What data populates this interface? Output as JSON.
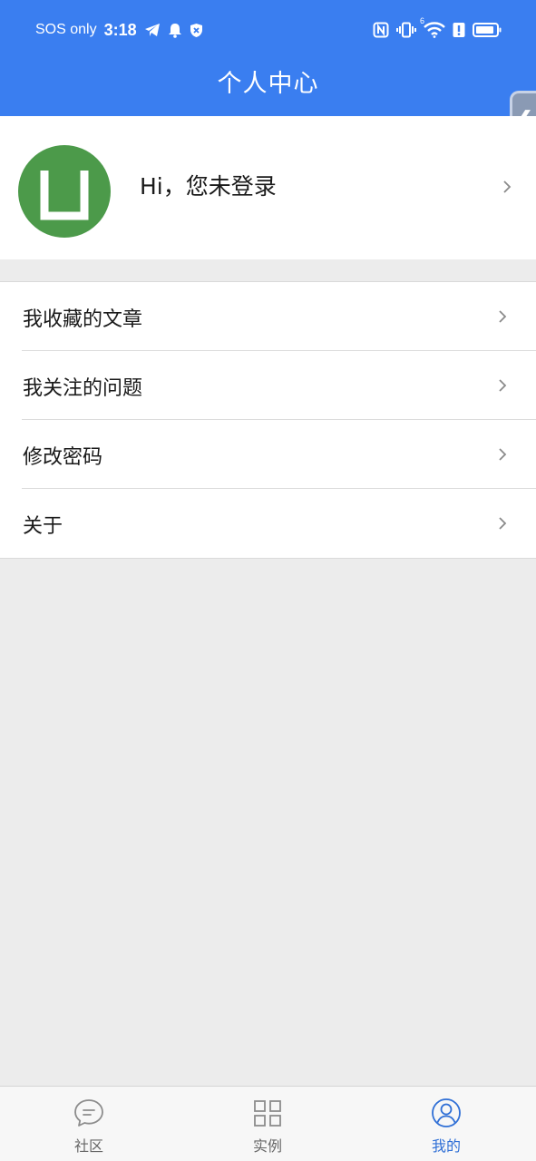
{
  "status_bar": {
    "carrier": "SOS only",
    "time": "3:18",
    "left_icons": [
      "telegram-icon",
      "bell-icon",
      "shield-icon"
    ],
    "right_icons": [
      "nfc-icon",
      "vibrate-icon",
      "wifi-icon",
      "alert-icon",
      "battery-icon"
    ],
    "wifi_badge": "6"
  },
  "header": {
    "title": "个人中心",
    "side_tab_glyph": "❮",
    "bg_color": "#3a7ef0"
  },
  "profile": {
    "avatar_glyph": "U",
    "avatar_color": "#4c9a4a",
    "greeting": "Hi，您未登录"
  },
  "menu": {
    "items": [
      {
        "label": "我收藏的文章"
      },
      {
        "label": "我关注的问题"
      },
      {
        "label": "修改密码"
      },
      {
        "label": "关于"
      }
    ]
  },
  "tabbar": {
    "tabs": [
      {
        "label": "社区",
        "icon": "chat-bubble-icon",
        "active": false
      },
      {
        "label": "实例",
        "icon": "grid-icon",
        "active": false
      },
      {
        "label": "我的",
        "icon": "user-circle-icon",
        "active": true
      }
    ],
    "active_color": "#2f6fd6"
  }
}
